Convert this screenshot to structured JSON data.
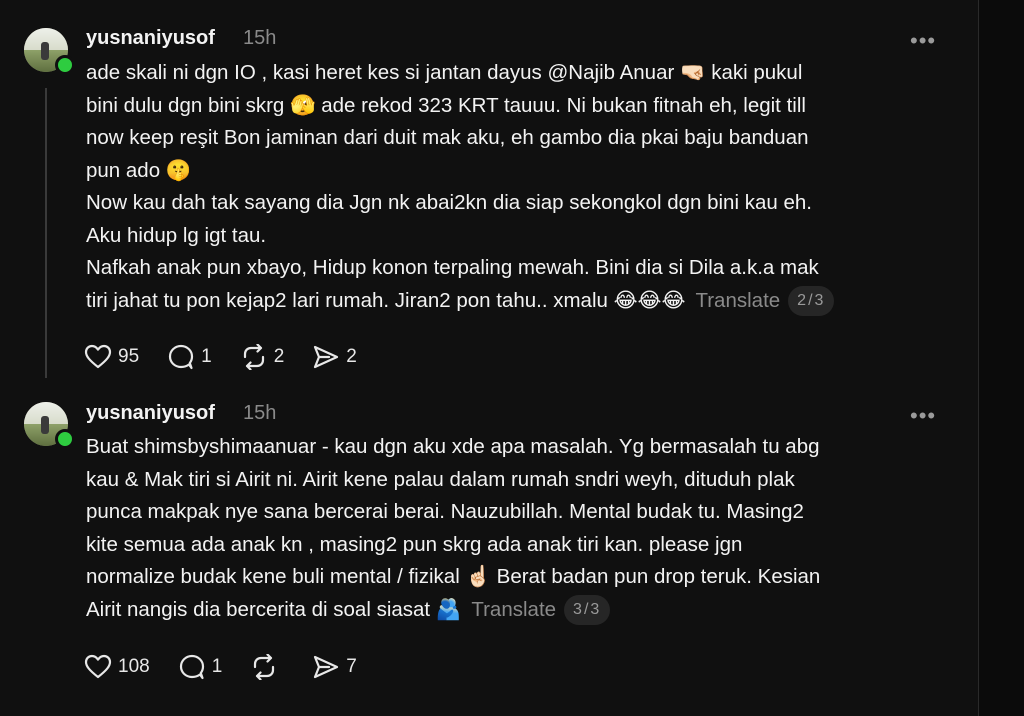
{
  "posts": [
    {
      "username": "yusnaniyusof",
      "time": "15h",
      "more_label": "•••",
      "text": "ade skali ni dgn IO , kasi heret kes si jantan dayus @Najib Anuar 🤜🏻 kaki pukul\nbini dulu dgn bini skrg 🫣 ade rekod 323 KRT tauuu. Ni bukan fitnah eh, legit till\nnow keep reşit Bon jaminan dari duit mak aku, eh gambo dia pkai baju banduan\npun ado 🤫\nNow kau dah tak sayang dia Jgn nk abai2kn dia siap sekongkol dgn bini kau eh.\nAku hidup lg igt tau.\nNafkah anak pun xbayo, Hidup konon terpaling mewah. Bini dia si Dila a.k.a mak\ntiri jahat tu pon kejap2 lari rumah. Jiran2 pon tahu.. xmalu 😂😂😂",
      "translate_label": "Translate",
      "page": "2/3",
      "likes": "95",
      "replies": "1",
      "reposts": "2",
      "shares": "2",
      "icons": [
        "heart-icon",
        "reply-icon",
        "repost-icon",
        "share-icon"
      ]
    },
    {
      "username": "yusnaniyusof",
      "time": "15h",
      "more_label": "•••",
      "text": "Buat shimsbyshimaanuar - kau dgn aku xde apa masalah. Yg bermasalah tu abg\nkau & Mak tiri si Airit ni. Airit kene palau dalam rumah sndri weyh, dituduh plak\npunca makpak nye sana bercerai berai. Nauzubillah. Mental budak tu. Masing2\nkite semua ada anak kn , masing2 pun skrg ada anak tiri kan. please jgn\nnormalize budak kene buli mental / fizikal ☝🏻 Berat badan pun drop teruk. Kesian\nAirit nangis dia bercerita di soal siasat 🫂",
      "translate_label": "Translate",
      "page": "3/3",
      "likes": "108",
      "replies": "1",
      "reposts": "",
      "shares": "7",
      "icons": [
        "heart-icon",
        "reply-icon",
        "repost-icon",
        "share-icon"
      ]
    }
  ],
  "colors": {
    "background": "#101010",
    "text": "#f3f3f3",
    "muted": "#8a8a8a",
    "online": "#2ecc40"
  }
}
